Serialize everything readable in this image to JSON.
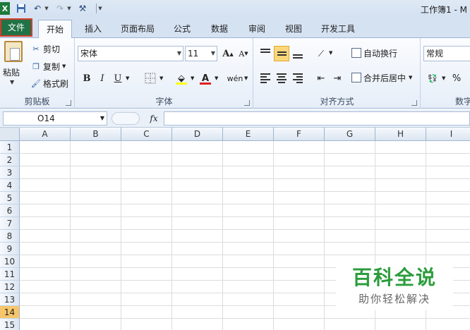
{
  "titlebar": {
    "app_icon": "X",
    "title": "工作簿1 - M",
    "icons": [
      "excel-app-icon",
      "save-icon",
      "undo-icon",
      "redo-icon",
      "customize-tool-icon"
    ]
  },
  "tabs": [
    {
      "label": "文件"
    },
    {
      "label": "开始"
    },
    {
      "label": "插入"
    },
    {
      "label": "页面布局"
    },
    {
      "label": "公式"
    },
    {
      "label": "数据"
    },
    {
      "label": "审阅"
    },
    {
      "label": "视图"
    },
    {
      "label": "开发工具"
    }
  ],
  "ribbon": {
    "clipboard": {
      "label": "剪贴板",
      "paste": "粘贴",
      "cut": "剪切",
      "copy": "复制",
      "format_painter": "格式刷"
    },
    "font": {
      "label": "字体",
      "font_name": "宋体",
      "font_size": "11",
      "bold": "B",
      "italic": "I",
      "underline": "U",
      "grow": "A",
      "shrink": "A",
      "font_color_letter": "A",
      "fill_color": "#ffff00",
      "font_color": "#e02020",
      "phonetic": "wén"
    },
    "alignment": {
      "label": "对齐方式",
      "wrap_text": "自动换行",
      "merge_center": "合并后居中"
    },
    "number": {
      "label": "数字",
      "format": "常规",
      "percent": "%"
    }
  },
  "formula_bar": {
    "name_box": "O14",
    "fx": "fx",
    "value": ""
  },
  "grid": {
    "columns": [
      "A",
      "B",
      "C",
      "D",
      "E",
      "F",
      "G",
      "H",
      "I"
    ],
    "rows": [
      "1",
      "2",
      "3",
      "4",
      "5",
      "6",
      "7",
      "8",
      "9",
      "10",
      "11",
      "12",
      "13",
      "14",
      "15"
    ],
    "active_row": "14"
  },
  "watermark": {
    "title": "百科全说",
    "subtitle": "助你轻松解决",
    "color": "#2c9c3c"
  }
}
